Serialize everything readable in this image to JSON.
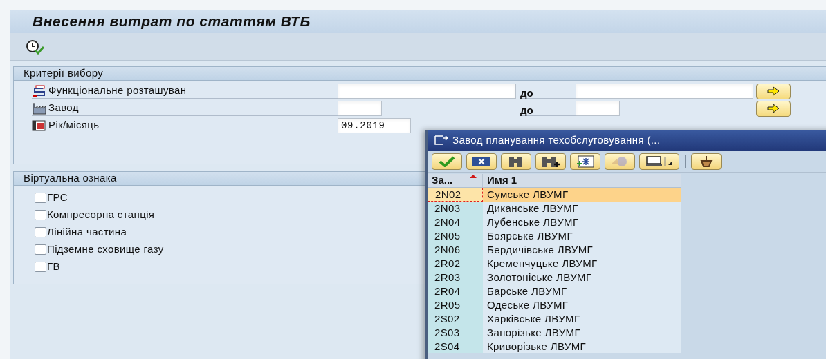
{
  "window": {
    "title": "Внесення витрат по статтям ВТБ"
  },
  "selection_criteria": {
    "title": "Критерії вибору",
    "rows": [
      {
        "kind": "range_wide",
        "label": "Функціональне розташуван",
        "to_label": "до"
      },
      {
        "kind": "range_narrow",
        "label": "Завод",
        "to_label": "до"
      },
      {
        "kind": "single",
        "label": "Рік/місяць",
        "value": "09.2019"
      }
    ]
  },
  "virtual_sign": {
    "title": "Віртуальна ознака",
    "options": [
      {
        "label": "ГРС",
        "checked": false
      },
      {
        "label": "Компресорна станція",
        "checked": false
      },
      {
        "label": "Лінійна частина",
        "checked": false
      },
      {
        "label": "Підземне сховище газу",
        "checked": false
      },
      {
        "label": "ГВ",
        "checked": false
      }
    ]
  },
  "popup": {
    "title": "Завод планування техобслуговування (...",
    "columns": [
      "За...",
      "Имя 1"
    ],
    "rows": [
      {
        "code": "2N02",
        "name": "Сумське ЛВУМГ",
        "selected": true
      },
      {
        "code": "2N03",
        "name": "Диканське ЛВУМГ",
        "selected": false
      },
      {
        "code": "2N04",
        "name": "Лубенське ЛВУМГ",
        "selected": false
      },
      {
        "code": "2N05",
        "name": "Боярське ЛВУМГ",
        "selected": false
      },
      {
        "code": "2N06",
        "name": "Бердичівське ЛВУМГ",
        "selected": false
      },
      {
        "code": "2R02",
        "name": "Кременчуцьке ЛВУМГ",
        "selected": false
      },
      {
        "code": "2R03",
        "name": "Золотоніське ЛВУМГ",
        "selected": false
      },
      {
        "code": "2R04",
        "name": "Барське ЛВУМГ",
        "selected": false
      },
      {
        "code": "2R05",
        "name": "Одеське ЛВУМГ",
        "selected": false
      },
      {
        "code": "2S02",
        "name": "Харківське ЛВУМГ",
        "selected": false
      },
      {
        "code": "2S03",
        "name": "Запорізьке ЛВУМГ",
        "selected": false
      },
      {
        "code": "2S04",
        "name": "Криворізьке ЛВУМГ",
        "selected": false
      }
    ]
  }
}
